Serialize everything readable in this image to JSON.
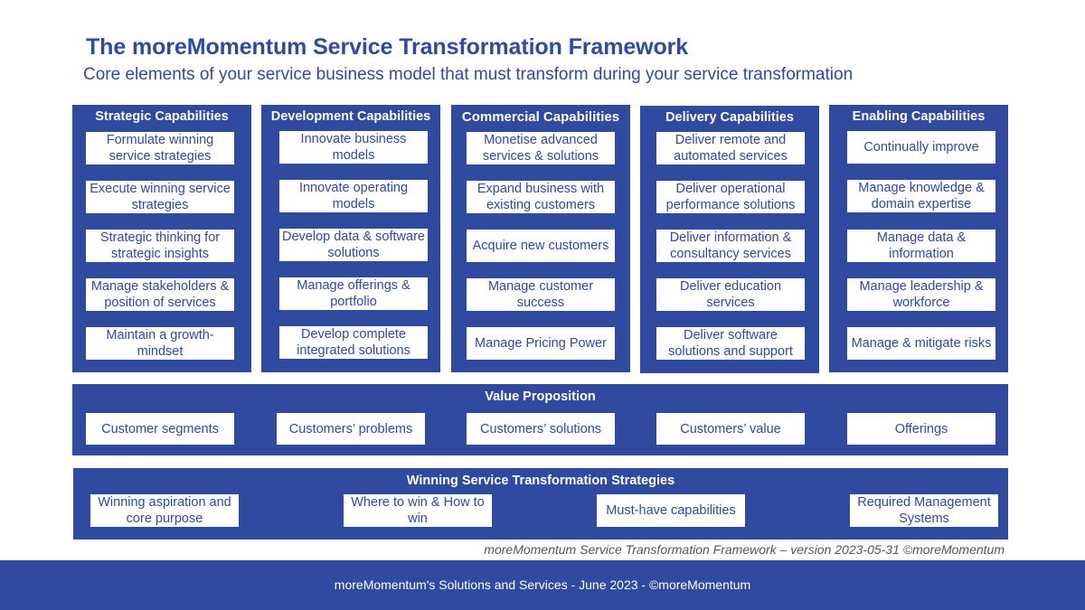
{
  "title": "The moreMomentum Service Transformation Framework",
  "subtitle": "Core elements of your service business model that must transform during your service transformation",
  "colors": {
    "brand_blue": "#2f4a9e",
    "box_white": "#ffffff",
    "version_gray": "#555555"
  },
  "capabilities": [
    {
      "heading": "Strategic Capabilities",
      "items": [
        "Formulate winning service strategies",
        "Execute winning service strategies",
        "Strategic thinking for strategic insights",
        "Manage stakeholders & position of services",
        "Maintain a growth-mindset"
      ]
    },
    {
      "heading": "Development Capabilities",
      "items": [
        "Innovate business models",
        "Innovate operating models",
        "Develop data & software solutions",
        "Manage offerings & portfolio",
        "Develop complete integrated solutions"
      ]
    },
    {
      "heading": "Commercial Capabilities",
      "items": [
        "Monetise advanced services & solutions",
        "Expand business with existing customers",
        "Acquire new customers",
        "Manage customer success",
        "Manage Pricing Power"
      ]
    },
    {
      "heading": "Delivery Capabilities",
      "items": [
        "Deliver remote and automated services",
        "Deliver operational performance solutions",
        "Deliver information & consultancy services",
        "Deliver education services",
        "Deliver software solutions and support"
      ]
    },
    {
      "heading": "Enabling Capabilities",
      "items": [
        "Continually improve",
        "Manage knowledge & domain expertise",
        "Manage data & information",
        "Manage leadership & workforce",
        "Manage & mitigate risks"
      ]
    }
  ],
  "value_proposition": {
    "heading": "Value Proposition",
    "items": [
      "Customer segments",
      "Customers’ problems",
      "Customers’ solutions",
      "Customers’ value",
      "Offerings"
    ]
  },
  "strategies": {
    "heading": "Winning Service Transformation Strategies",
    "items": [
      "Winning aspiration and core purpose",
      "Where to win & How to win",
      "Must-have capabilities",
      "Required Management Systems"
    ]
  },
  "version_note": "moreMomentum Service Transformation Framework – version 2023-05-31 ©moreMomentum",
  "footer": "moreMomentum's Solutions and Services - June 2023 - ©moreMomentum"
}
